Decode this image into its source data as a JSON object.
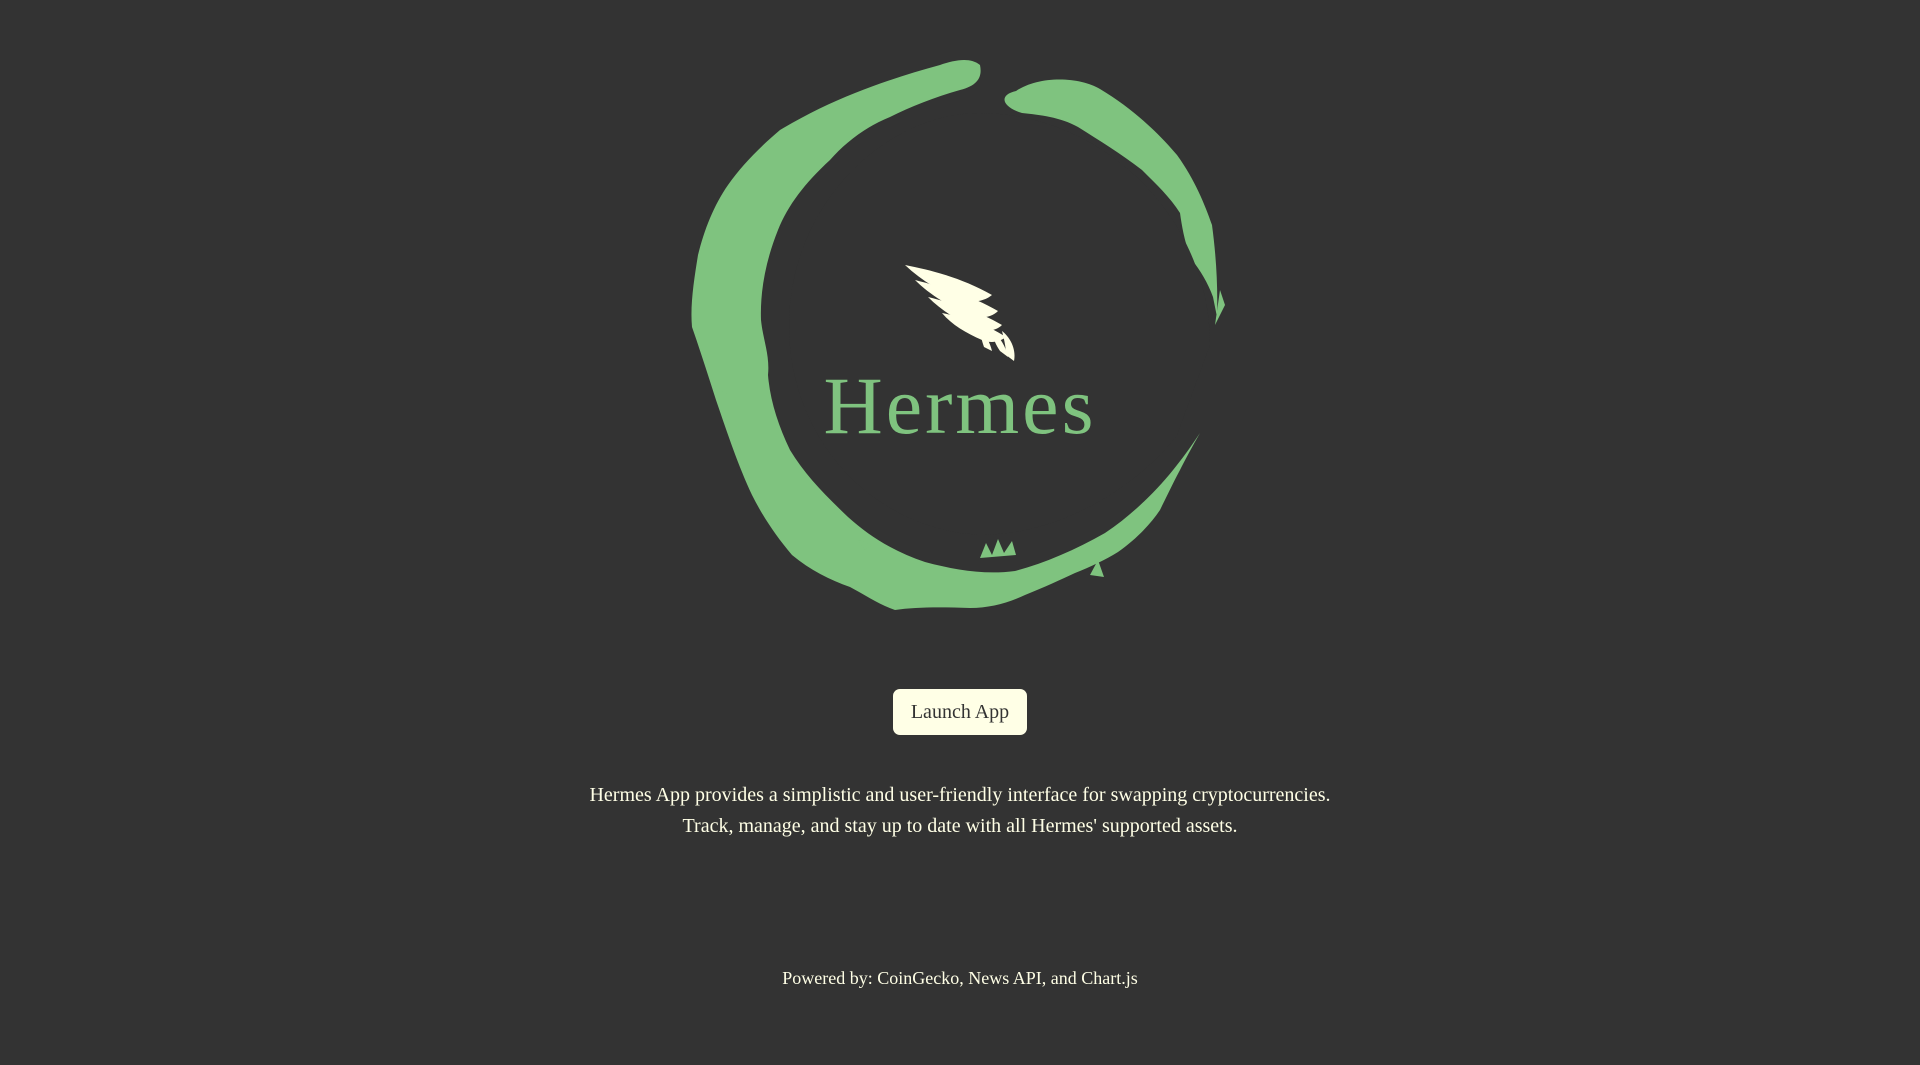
{
  "colors": {
    "background": "#333333",
    "brand_green": "#7FC37F",
    "cream": "#FFFFE6"
  },
  "logo": {
    "wordmark": "Hermes",
    "ring_icon": "brush-ring-icon",
    "wing_icon": "wing-icon"
  },
  "hero": {
    "launch_label": "Launch App"
  },
  "description": {
    "line1": "Hermes App provides a simplistic and user-friendly interface for swapping cryptocurrencies.",
    "line2": "Track, manage, and stay up to date with all Hermes' supported assets."
  },
  "footer": {
    "powered_by": "Powered by: CoinGecko, News API, and Chart.js"
  }
}
